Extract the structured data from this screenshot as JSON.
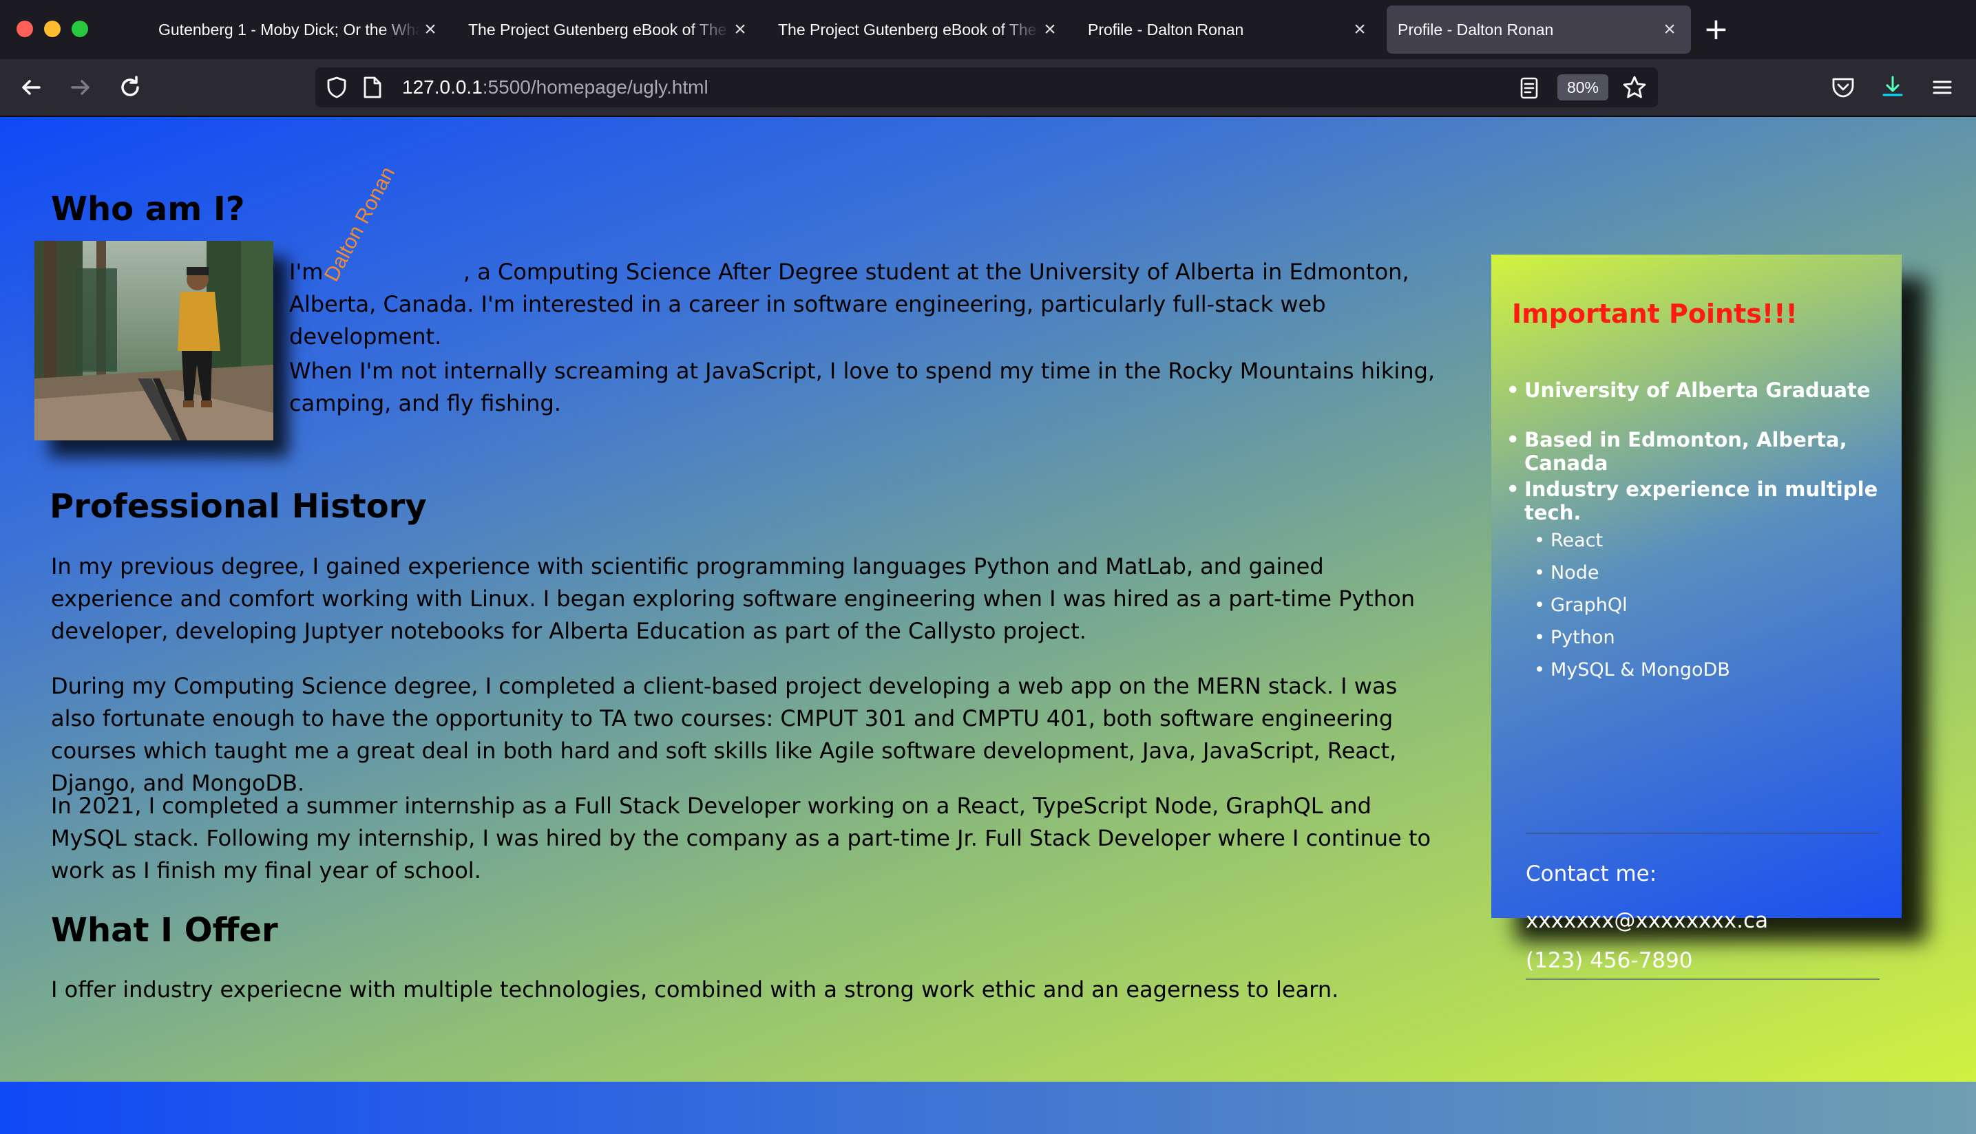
{
  "browser": {
    "tabs": [
      {
        "title": "Gutenberg 1 - Moby Dick; Or the Whale",
        "active": false
      },
      {
        "title": "The Project Gutenberg eBook of The",
        "active": false
      },
      {
        "title": "The Project Gutenberg eBook of The",
        "active": false
      },
      {
        "title": "Profile - Dalton Ronan",
        "active": false
      },
      {
        "title": "Profile - Dalton Ronan",
        "active": true
      }
    ],
    "new_tab": "+",
    "url_host": "127.0.0.1",
    "url_rest": ":5500/homepage/ugly.html",
    "zoom": "80%"
  },
  "page": {
    "who_heading": "Who am I?",
    "intro_1": "I'm                    , a Computing Science After Degree student at the University of Alberta in Edmonton, Alberta, Canada. I'm interested in a career in software engineering, particularly full-stack web development.",
    "intro_2": "When I'm not internally screaming at JavaScript, I love to spend my time in the Rocky Mountains hiking, camping, and fly fishing.",
    "rotated_name": "Dalton Ronan",
    "history_heading": "Professional History",
    "history_1": "In my previous degree, I gained experience with scientific programming languages Python and MatLab, and gained experience and comfort working with Linux. I began exploring software engineering when I was hired as a part-time Python developer, developing Juptyer notebooks for Alberta Education as part of the Callysto project.",
    "history_2": "During my Computing Science degree, I completed a client-based project developing a web app on the MERN stack. I was also fortunate enough to have the opportunity to TA two courses: CMPUT 301 and CMPTU 401, both software engineering courses which taught me a great deal in both hard and soft skills like Agile software development, Java, JavaScript, React, Django, and MongoDB.",
    "history_3": "In 2021, I completed a summer internship as a Full Stack Developer working on a React, TypeScript Node, GraphQL and MySQL stack. Following my internship, I was hired by the company as a part-time Jr. Full Stack Developer where I continue to work as I finish my final year of school.",
    "offer_heading": "What I Offer",
    "offer_text": "I offer industry experiecne with multiple technologies, combined with a strong work ethic and an eagerness to learn."
  },
  "card": {
    "title": "Important Points!!!",
    "points": [
      "University of Alberta Graduate",
      "Based in Edmonton, Alberta, Canada",
      "Industry experience in multiple tech."
    ],
    "tech": [
      "React",
      "Node",
      "GraphQl",
      "Python",
      "MySQL & MongoDB"
    ],
    "contact_label": "Contact me:",
    "email": "xxxxxxx@xxxxxxxx.ca",
    "phone": "(123) 456-7890"
  }
}
